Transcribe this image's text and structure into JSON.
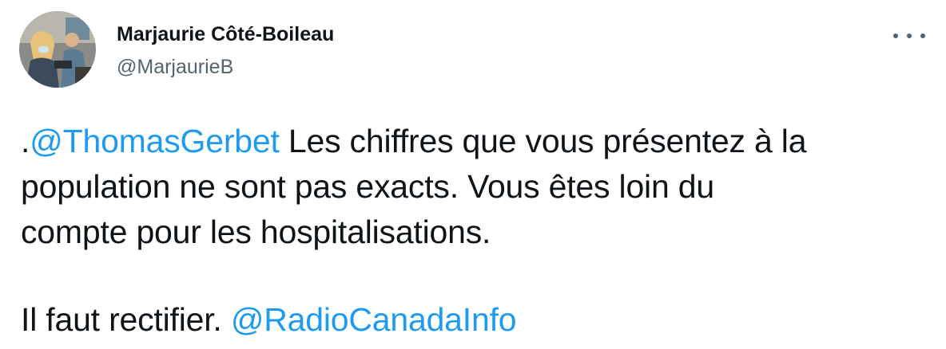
{
  "user": {
    "display_name": "Marjaurie Côté-Boileau",
    "handle": "@MarjaurieB"
  },
  "colors": {
    "link": "#1d9bf0",
    "text": "#0f1419",
    "secondary": "#536471"
  },
  "icons": {
    "more": "more-options-icon"
  },
  "tweet": {
    "line1_prefix": ".",
    "line1_mention": "@ThomasGerbet",
    "line1_rest": " Les chiffres que vous présentez à la",
    "line2": "population ne sont pas exacts. Vous êtes loin du",
    "line3": "compte pour les hospitalisations.",
    "line4_text": "Il faut rectifier. ",
    "line4_mention": "@RadioCanadaInfo"
  }
}
